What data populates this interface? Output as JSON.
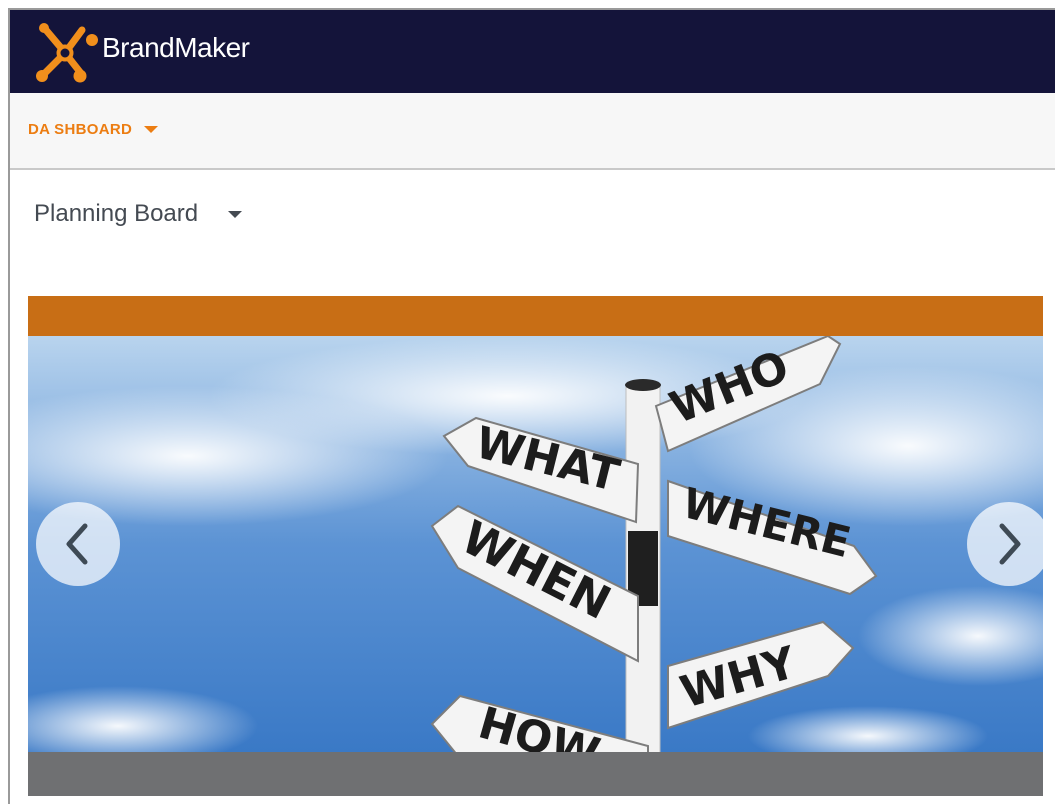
{
  "header": {
    "brand_name": "BrandMaker",
    "logo_icon": "brandmaker-x-logo",
    "background_color": "#14143a",
    "logo_color": "#f18f1c"
  },
  "nav": {
    "dashboard_label": "DA SHBOARD",
    "accent_color": "#ec7d12"
  },
  "board": {
    "title": "Planning Board"
  },
  "carousel": {
    "header_color": "#c86e15",
    "footer_color": "#6f7072",
    "image": {
      "signs": [
        "WHO",
        "WHAT",
        "WHERE",
        "WHEN",
        "WHY",
        "HOW"
      ]
    },
    "prev_icon": "chevron-left-icon",
    "next_icon": "chevron-right-icon"
  }
}
